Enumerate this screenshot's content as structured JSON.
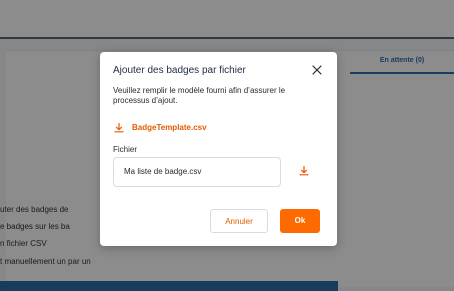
{
  "background": {
    "tab_label": "En attente (0)",
    "help_lines": [
      "uter des badges de",
      "e badges sur les ba",
      "n fichier CSV",
      "t manuellement un par un"
    ],
    "colors": {
      "accent_blue": "#2d6fa6"
    }
  },
  "modal": {
    "title": "Ajouter des badges par fichier",
    "close_icon": "close-icon",
    "description": "Veuillez remplir le modèle fourni afin d’assurer le processus d’ajout.",
    "template": {
      "icon": "download-icon",
      "label": "BadgeTemplate.csv"
    },
    "file_field": {
      "label": "Fichier",
      "value": "Ma liste de badge.csv",
      "upload_icon": "download-icon"
    },
    "buttons": {
      "cancel": "Annuler",
      "ok": "Ok"
    },
    "colors": {
      "primary": "#ff6a00",
      "link": "#e35b00",
      "title": "#1f2a44"
    }
  }
}
